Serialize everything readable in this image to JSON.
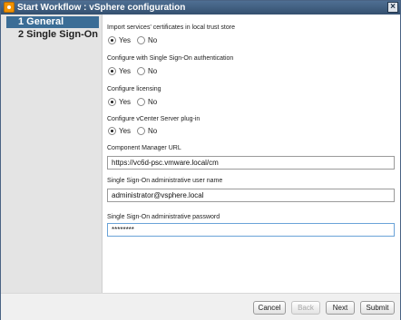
{
  "window": {
    "title": "Start Workflow : vSphere configuration",
    "close_glyph": "×"
  },
  "sidebar": {
    "steps": [
      {
        "label": "1  General",
        "active": true
      },
      {
        "label": "2  Single Sign-On",
        "active": false
      }
    ]
  },
  "form": {
    "import_certs": {
      "label": "Import services' certificates in local trust store",
      "selected": "Yes"
    },
    "configure_sso": {
      "label": "Configure with Single Sign-On authentication",
      "selected": "Yes"
    },
    "configure_licensing": {
      "label": "Configure licensing",
      "selected": "Yes"
    },
    "configure_plugin": {
      "label": "Configure vCenter Server plug-in",
      "selected": "Yes"
    },
    "yes_label": "Yes",
    "no_label": "No",
    "component_manager_url": {
      "label": "Component Manager URL",
      "value": "https://vc6d-psc.vmware.local/cm"
    },
    "sso_admin_user": {
      "label": "Single Sign-On administrative user name",
      "value": "administrator@vsphere.local"
    },
    "sso_admin_password": {
      "label": "Single Sign-On administrative password",
      "value": "********"
    }
  },
  "footer": {
    "cancel_label": "Cancel",
    "back_label": "Back",
    "next_label": "Next",
    "submit_label": "Submit"
  },
  "colors": {
    "titlebar": "#3f5e80",
    "active_step": "#3b6d96",
    "title_icon": "#f29200"
  }
}
